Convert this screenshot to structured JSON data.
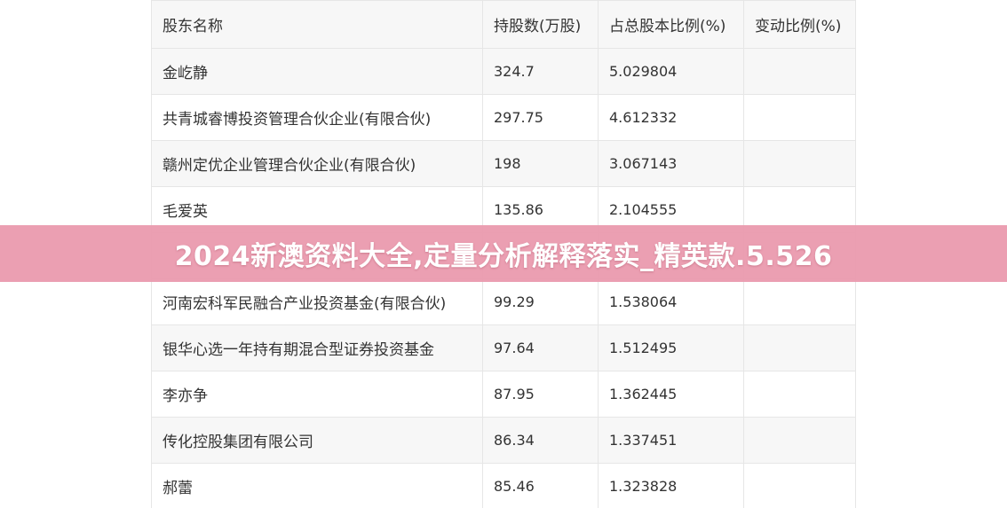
{
  "table": {
    "headers": {
      "name": "股东名称",
      "shares": "持股数(万股)",
      "ratio": "占总股本比例(%)",
      "change": "变动比例(%)"
    },
    "rows": [
      {
        "name": "金屹静",
        "shares": "324.7",
        "ratio": "5.029804",
        "change": ""
      },
      {
        "name": "共青城睿博投资管理合伙企业(有限合伙)",
        "shares": "297.75",
        "ratio": "4.612332",
        "change": ""
      },
      {
        "name": "赣州定优企业管理合伙企业(有限合伙)",
        "shares": "198",
        "ratio": "3.067143",
        "change": ""
      },
      {
        "name": "毛爱英",
        "shares": "135.86",
        "ratio": "2.104555",
        "change": ""
      },
      {
        "name": "",
        "shares": "",
        "ratio": "",
        "change": ""
      },
      {
        "name": "河南宏科军民融合产业投资基金(有限合伙)",
        "shares": "99.29",
        "ratio": "1.538064",
        "change": ""
      },
      {
        "name": "银华心选一年持有期混合型证券投资基金",
        "shares": "97.64",
        "ratio": "1.512495",
        "change": ""
      },
      {
        "name": "李亦争",
        "shares": "87.95",
        "ratio": "1.362445",
        "change": ""
      },
      {
        "name": "传化控股集团有限公司",
        "shares": "86.34",
        "ratio": "1.337451",
        "change": ""
      },
      {
        "name": "郝蕾",
        "shares": "85.46",
        "ratio": "1.323828",
        "change": ""
      }
    ]
  },
  "banner": {
    "title": "2024新澳资料大全,定量分析解释落实_精英款.5.526"
  }
}
